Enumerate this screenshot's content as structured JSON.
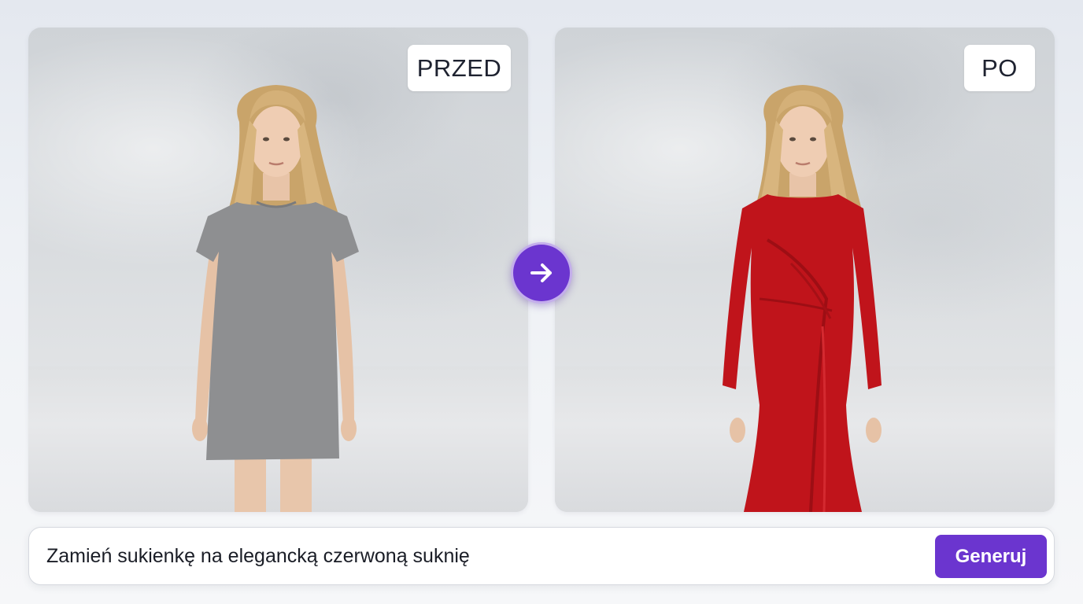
{
  "before_panel": {
    "badge_label": "PRZED",
    "garment_color": "#8e8f91"
  },
  "after_panel": {
    "badge_label": "PO",
    "garment_color": "#c0141b"
  },
  "arrow_button": {
    "icon": "arrow-right-icon",
    "color": "#6b35cf"
  },
  "prompt": {
    "text": "Zamień sukienkę na elegancką czerwoną suknię",
    "generate_label": "Generuj",
    "accent": "#6b35cf"
  }
}
